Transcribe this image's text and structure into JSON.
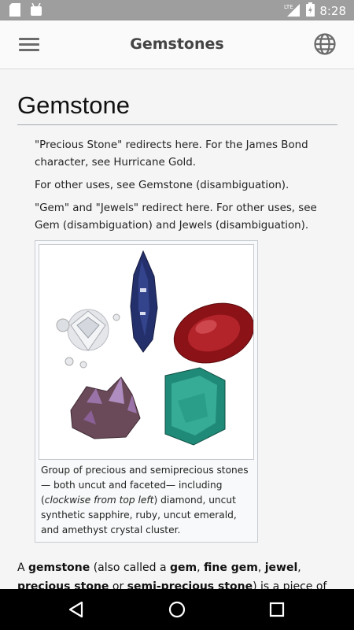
{
  "status_bar": {
    "time": "8:28",
    "network": "LTE",
    "icons": [
      "sd-card-icon",
      "android-icon",
      "signal-icon",
      "battery-icon"
    ]
  },
  "app_bar": {
    "title": "Gemstones",
    "menu_icon": "hamburger-menu-icon",
    "language_icon": "globe-icon"
  },
  "article": {
    "heading": "Gemstone",
    "hatnotes": [
      "\"Precious Stone\" redirects here. For the James Bond character, see Hurricane Gold.",
      "For other uses, see Gemstone (disambiguation).",
      "\"Gem\" and \"Jewels\" redirect here. For other uses, see Gem (disambiguation) and Jewels (disambiguation)."
    ],
    "figure": {
      "image_alt": "Group of precious and semiprecious stones",
      "caption_part1": "Group of precious and semiprecious stones — both uncut and faceted— including (",
      "caption_italic": "clockwise from top left",
      "caption_part2": ") diamond, uncut synthetic sapphire, ruby, uncut emerald, and amethyst crystal cluster."
    },
    "lead": {
      "t1": "A ",
      "b1": "gemstone",
      "t2": " (also called a ",
      "b2": "gem",
      "t3": ", ",
      "b3": "fine gem",
      "t4": ", ",
      "b4": "jewel",
      "t5": ", ",
      "b5": "precious stone",
      "t6": " or ",
      "b6": "semi-precious stone",
      "t7": ") is a piece of mineral crystal"
    }
  },
  "nav_bar": {
    "icons": [
      "back-icon",
      "home-icon",
      "recents-icon"
    ]
  },
  "colors": {
    "status_bar": "#9e9e9e",
    "app_bar": "#fafafa",
    "background": "#f5f5f5",
    "nav_bar": "#000000"
  }
}
